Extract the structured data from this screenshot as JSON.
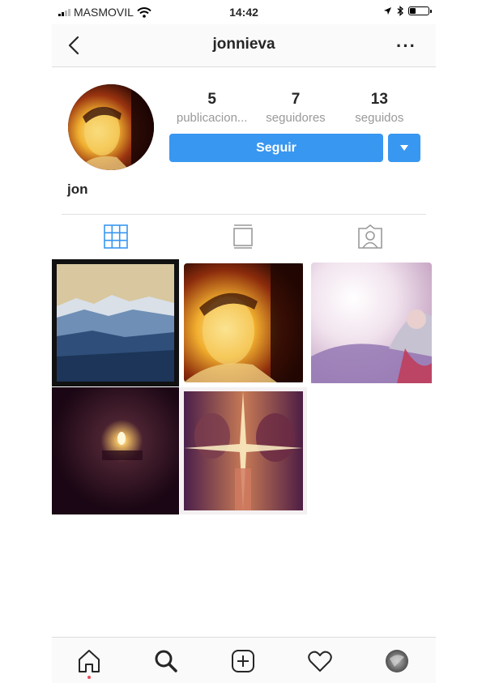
{
  "status_bar": {
    "carrier": "MASMOVIL",
    "time": "14:42"
  },
  "header": {
    "username": "jonnieva"
  },
  "profile": {
    "stats": [
      {
        "value": "5",
        "label": "publicacion..."
      },
      {
        "value": "7",
        "label": "seguidores"
      },
      {
        "value": "13",
        "label": "seguidos"
      }
    ],
    "follow_label": "Seguir",
    "name": "jon"
  },
  "icons": {
    "back": "chevron-left-icon",
    "more": "more-dots-icon",
    "grid_view": "grid-icon",
    "list_view": "feed-list-icon",
    "tagged": "tagged-person-icon",
    "home": "home-icon",
    "search": "search-icon",
    "new_post": "plus-square-icon",
    "activity": "heart-icon",
    "profile": "avatar"
  },
  "colors": {
    "accent": "#3897f0",
    "notification_dot": "#ed4956"
  }
}
